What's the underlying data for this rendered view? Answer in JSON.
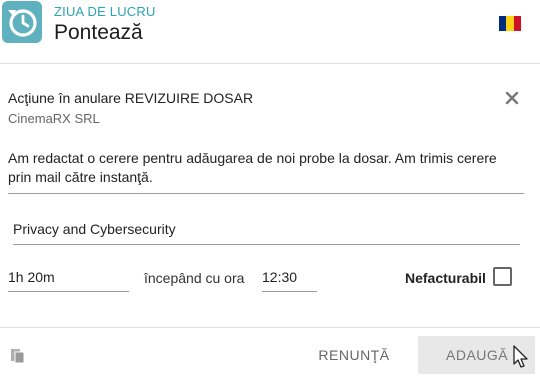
{
  "header": {
    "brand_sub": "ZIUA DE LUCRU",
    "title": "Pontează",
    "logo_icon": "clock-refresh-icon",
    "flag_colors": [
      "#002b7f",
      "#fcd116",
      "#ce1126"
    ]
  },
  "entry": {
    "action_title": "Acţiune în anulare REVIZUIRE DOSAR",
    "company": "CinemaRX SRL",
    "description_line1": "Am redactat o cerere pentru adăugarea de noi probe la dosar. Am trimis cerere",
    "description_line2": "prin mail către instanţă.",
    "project": "Privacy and Cybersecurity",
    "duration": "1h 20m",
    "starting_label": "începând cu ora",
    "start_time": "12:30",
    "nonbillable_label": "Nefacturabil",
    "nonbillable_checked": false
  },
  "footer": {
    "cancel_label": "RENUNŢĂ",
    "add_label": "ADAUGĂ"
  },
  "colors": {
    "accent": "#2aa3b3",
    "logo_bg": "#5fb1c0",
    "disabled_button_bg": "#e8e8e8"
  }
}
